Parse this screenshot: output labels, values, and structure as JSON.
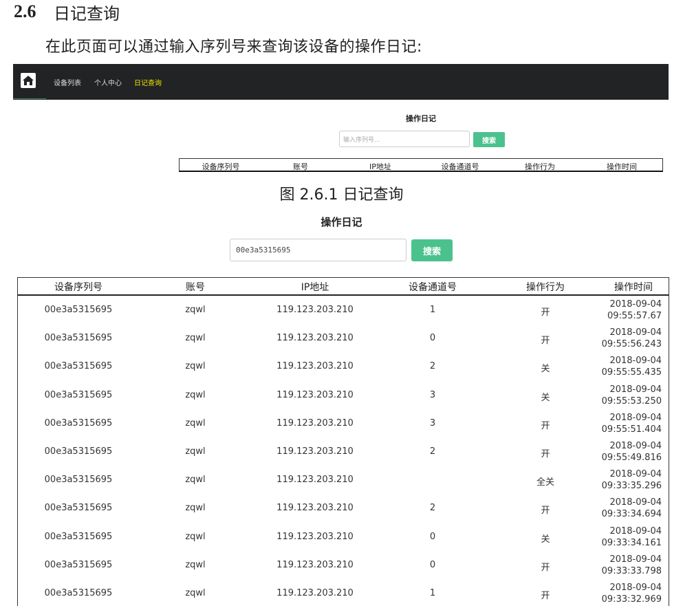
{
  "doc": {
    "section_number": "2.6",
    "section_title": "日记查询",
    "intro": "在此页面可以通过输入序列号来查询该设备的操作日记:",
    "caption": "图 2.6.1  日记查询"
  },
  "navbar": {
    "home_icon": "home-icon",
    "items": [
      "设备列表",
      "个人中心",
      "日记查询"
    ],
    "active": "日记查询"
  },
  "small": {
    "title": "操作日记",
    "search_placeholder": "输入序列号...",
    "search_button": "搜索",
    "headers": [
      "设备序列号",
      "账号",
      "IP地址",
      "设备通道号",
      "操作行为",
      "操作时间"
    ]
  },
  "large": {
    "title": "操作日记",
    "search_value": "00e3a5315695",
    "search_button": "搜索",
    "headers": [
      "设备序列号",
      "账号",
      "IP地址",
      "设备通道号",
      "操作行为",
      "操作时间"
    ],
    "rows": [
      {
        "serial": "00e3a5315695",
        "account": "zqwl",
        "ip": "119.123.203.210",
        "channel": "1",
        "action": "开",
        "date": "2018-09-04",
        "time": "09:55:57.67"
      },
      {
        "serial": "00e3a5315695",
        "account": "zqwl",
        "ip": "119.123.203.210",
        "channel": "0",
        "action": "开",
        "date": "2018-09-04",
        "time": "09:55:56.243"
      },
      {
        "serial": "00e3a5315695",
        "account": "zqwl",
        "ip": "119.123.203.210",
        "channel": "2",
        "action": "关",
        "date": "2018-09-04",
        "time": "09:55:55.435"
      },
      {
        "serial": "00e3a5315695",
        "account": "zqwl",
        "ip": "119.123.203.210",
        "channel": "3",
        "action": "关",
        "date": "2018-09-04",
        "time": "09:55:53.250"
      },
      {
        "serial": "00e3a5315695",
        "account": "zqwl",
        "ip": "119.123.203.210",
        "channel": "3",
        "action": "开",
        "date": "2018-09-04",
        "time": "09:55:51.404"
      },
      {
        "serial": "00e3a5315695",
        "account": "zqwl",
        "ip": "119.123.203.210",
        "channel": "2",
        "action": "开",
        "date": "2018-09-04",
        "time": "09:55:49.816"
      },
      {
        "serial": "00e3a5315695",
        "account": "zqwl",
        "ip": "119.123.203.210",
        "channel": "",
        "action": "全关",
        "date": "2018-09-04",
        "time": "09:33:35.296"
      },
      {
        "serial": "00e3a5315695",
        "account": "zqwl",
        "ip": "119.123.203.210",
        "channel": "2",
        "action": "开",
        "date": "2018-09-04",
        "time": "09:33:34.694"
      },
      {
        "serial": "00e3a5315695",
        "account": "zqwl",
        "ip": "119.123.203.210",
        "channel": "0",
        "action": "关",
        "date": "2018-09-04",
        "time": "09:33:34.161"
      },
      {
        "serial": "00e3a5315695",
        "account": "zqwl",
        "ip": "119.123.203.210",
        "channel": "0",
        "action": "开",
        "date": "2018-09-04",
        "time": "09:33:33.798"
      },
      {
        "serial": "00e3a5315695",
        "account": "zqwl",
        "ip": "119.123.203.210",
        "channel": "1",
        "action": "开",
        "date": "2018-09-04",
        "time": "09:33:32.969"
      }
    ]
  }
}
